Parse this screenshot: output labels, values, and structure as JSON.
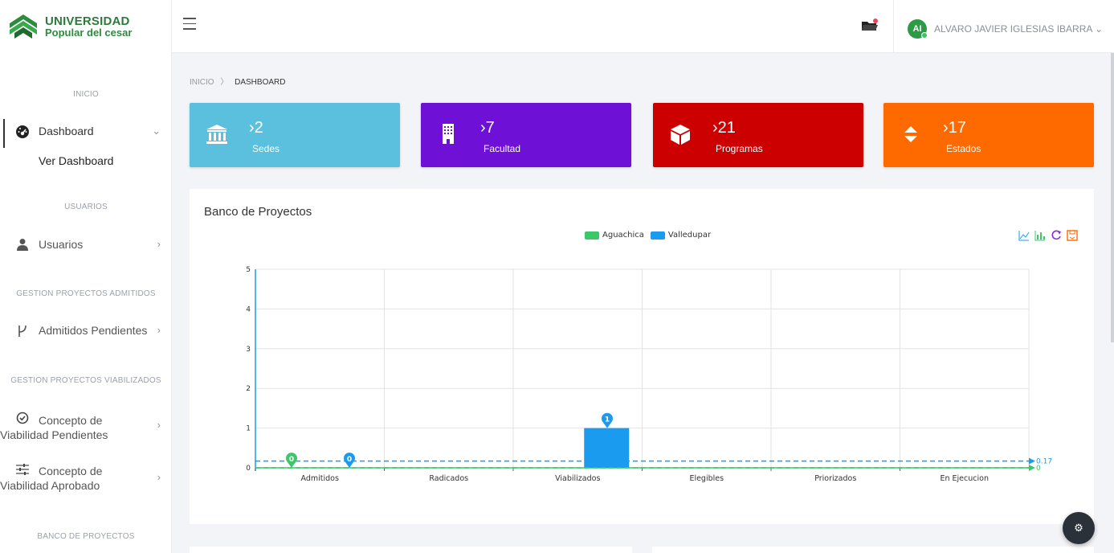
{
  "brand": {
    "title": "UNIVERSIDAD",
    "subtitle": "Popular del cesar",
    "accent": "#2d7b3a"
  },
  "sidebar": {
    "sections": [
      {
        "label": "INICIO"
      },
      {
        "label": "USUARIOS"
      },
      {
        "label": "GESTION PROYECTOS ADMITIDOS"
      },
      {
        "label": "GESTION PROYECTOS VIABILIZADOS"
      },
      {
        "label": "BANCO DE PROYECTOS"
      }
    ],
    "items": [
      {
        "label": "Dashboard",
        "icon": "dashboard-icon"
      },
      {
        "label": "Ver Dashboard"
      },
      {
        "label": "Usuarios",
        "icon": "user-icon"
      },
      {
        "label": "Admitidos Pendientes",
        "icon": "branch-icon"
      },
      {
        "label_line1": "Concepto de",
        "label_line2": "Viabilidad Pendientes",
        "icon": "check-circle-icon"
      },
      {
        "label_line1": "Concepto de",
        "label_line2": "Viabilidad Aprobado",
        "icon": "sliders-icon"
      }
    ]
  },
  "topbar": {
    "user_initials": "AI",
    "user_name": "ALVARO JAVIER IGLESIAS IBARRA"
  },
  "breadcrumb": {
    "home": "INICIO",
    "current": "DASHBOARD"
  },
  "stats": [
    {
      "value": "2",
      "label": "Sedes",
      "color": "#5bc0de",
      "icon": "bank-icon"
    },
    {
      "value": "7",
      "label": "Facultad",
      "color": "#6f10d6",
      "icon": "building-icon"
    },
    {
      "value": "21",
      "label": "Programas",
      "color": "#cc0000",
      "icon": "box-icon"
    },
    {
      "value": "17",
      "label": "Estados",
      "color": "#ff6a00",
      "icon": "sort-icon"
    }
  ],
  "panel": {
    "title": "Banco de Proyectos"
  },
  "chart_data": {
    "type": "bar",
    "categories": [
      "Admitidos",
      "Radicados",
      "Viabilizados",
      "Elegibles",
      "Priorizados",
      "En Ejecucion"
    ],
    "series": [
      {
        "name": "Aguachica",
        "values": [
          0,
          0,
          0,
          0,
          0,
          0
        ],
        "color": "#3cc76a"
      },
      {
        "name": "Valledupar",
        "values": [
          0,
          0,
          1,
          0,
          0,
          0
        ],
        "color": "#1a9bf0"
      }
    ],
    "markers": [
      {
        "series": "Aguachica",
        "category": "Admitidos",
        "value": 0
      },
      {
        "series": "Valledupar",
        "category": "Admitidos",
        "value": 0
      },
      {
        "series": "Valledupar",
        "category": "Viabilizados",
        "value": 1
      }
    ],
    "average_lines": [
      {
        "series": "Valledupar",
        "value": 0.17,
        "label": "0.17"
      },
      {
        "series": "Aguachica",
        "value": 0,
        "label": "0"
      }
    ],
    "y_ticks": [
      "0",
      "1",
      "2",
      "3",
      "4",
      "5"
    ],
    "ylim": [
      0,
      5
    ],
    "grid": true,
    "legend_position": "top-center"
  },
  "colors": {
    "sidebar_bg": "#ffffff",
    "content_bg": "#f3f4f7",
    "fab": "#2b3138"
  }
}
